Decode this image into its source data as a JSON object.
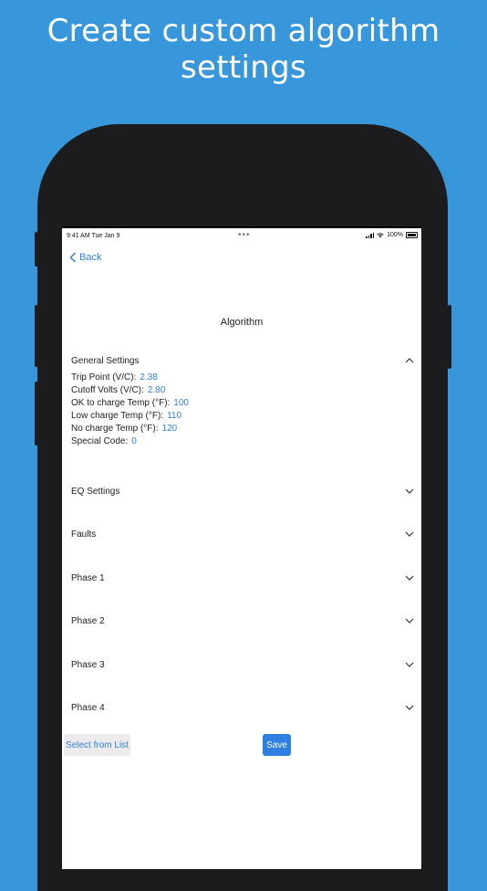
{
  "headline": "Create custom algorithm settings",
  "status_bar": {
    "time": "9:41 AM   Tue Jan 9",
    "battery": "100%"
  },
  "nav": {
    "back_label": "Back"
  },
  "page_title": "Algorithm",
  "general": {
    "title": "General Settings",
    "fields": [
      {
        "label": "Trip Point (V/C):",
        "value": "2.38"
      },
      {
        "label": "Cutoff Volts (V/C):",
        "value": "2.80"
      },
      {
        "label": "OK to charge Temp (°F):",
        "value": "100"
      },
      {
        "label": "Low charge Temp (°F):",
        "value": "110"
      },
      {
        "label": "No charge Temp (°F):",
        "value": "120"
      },
      {
        "label": "Special Code:",
        "value": "0"
      }
    ]
  },
  "sections": [
    {
      "title": "EQ Settings"
    },
    {
      "title": "Faults"
    },
    {
      "title": "Phase 1"
    },
    {
      "title": "Phase 2"
    },
    {
      "title": "Phase 3"
    },
    {
      "title": "Phase 4"
    }
  ],
  "buttons": {
    "select_from_list": "Select from List",
    "save": "Save"
  },
  "colors": {
    "background": "#3896da",
    "accent": "#2f7fe0",
    "device": "#1c1c1e"
  }
}
